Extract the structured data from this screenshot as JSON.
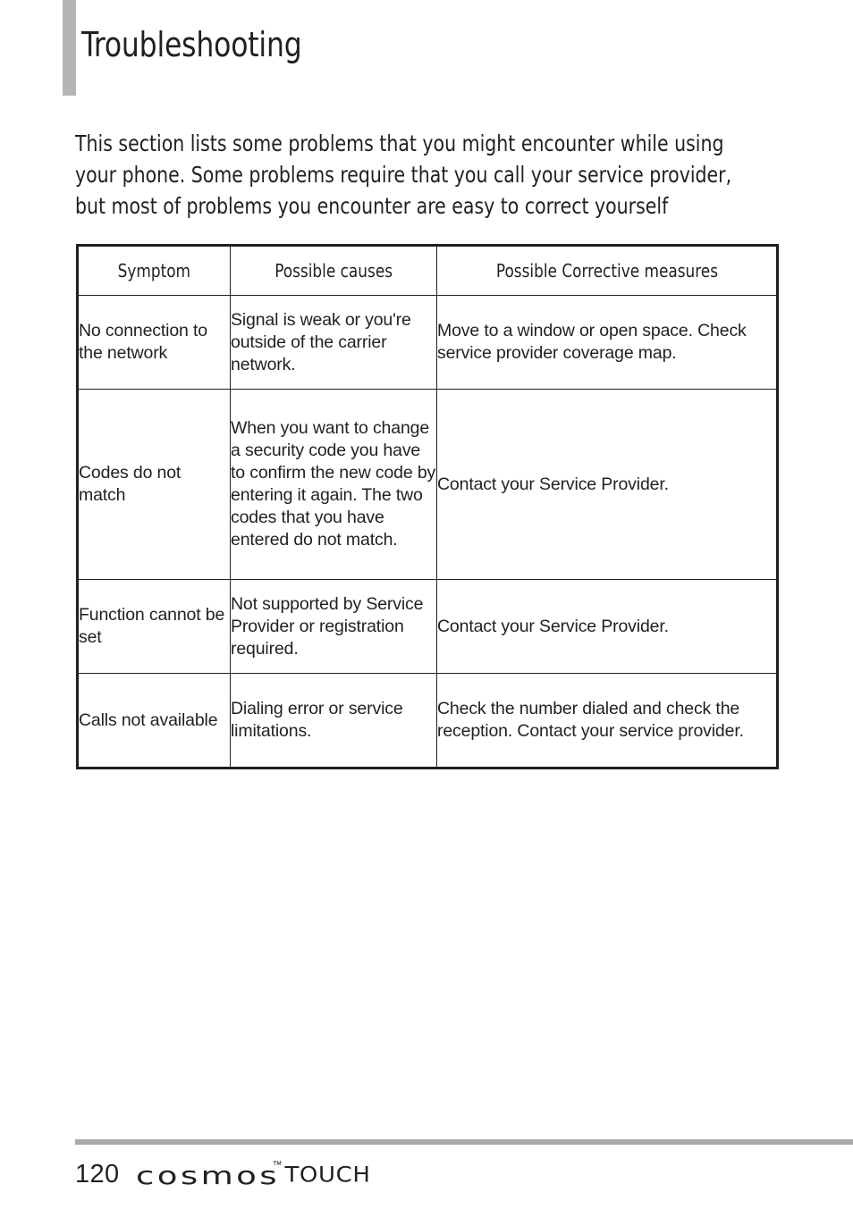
{
  "page": {
    "title": "Troubleshooting",
    "intro": "This section lists some problems that you might encounter while using your phone. Some problems require that you call your service provider, but most of problems you encounter are easy to correct yourself",
    "accent_bar_color": "#b5b5b5",
    "text_color": "#231f20",
    "rule_color": "#a7a9ac"
  },
  "table": {
    "headers": [
      "Symptom",
      "Possible causes",
      "Possible Corrective measures"
    ],
    "rows": [
      {
        "symptom": "No connection to the network",
        "cause": "Signal is weak or you're outside of the carrier network.",
        "fix": "Move to a window or open space. Check service provider coverage map."
      },
      {
        "symptom": "Codes do not match",
        "cause": "When you want to change a security code you have to confirm the new code by entering it again. The two codes that you have entered do not match.",
        "fix": "Contact your Service Provider."
      },
      {
        "symptom": "Function cannot be set",
        "cause": "Not supported by Service Provider or registration required.",
        "fix": "Contact your Service Provider."
      },
      {
        "symptom": "Calls not available",
        "cause": "Dialing error or service limitations.",
        "fix": "Check the number dialed and check the reception. Contact your service provider."
      }
    ]
  },
  "footer": {
    "page_number": "120",
    "brand": "cosmos",
    "trademark": "™",
    "product": "TOUCH"
  }
}
